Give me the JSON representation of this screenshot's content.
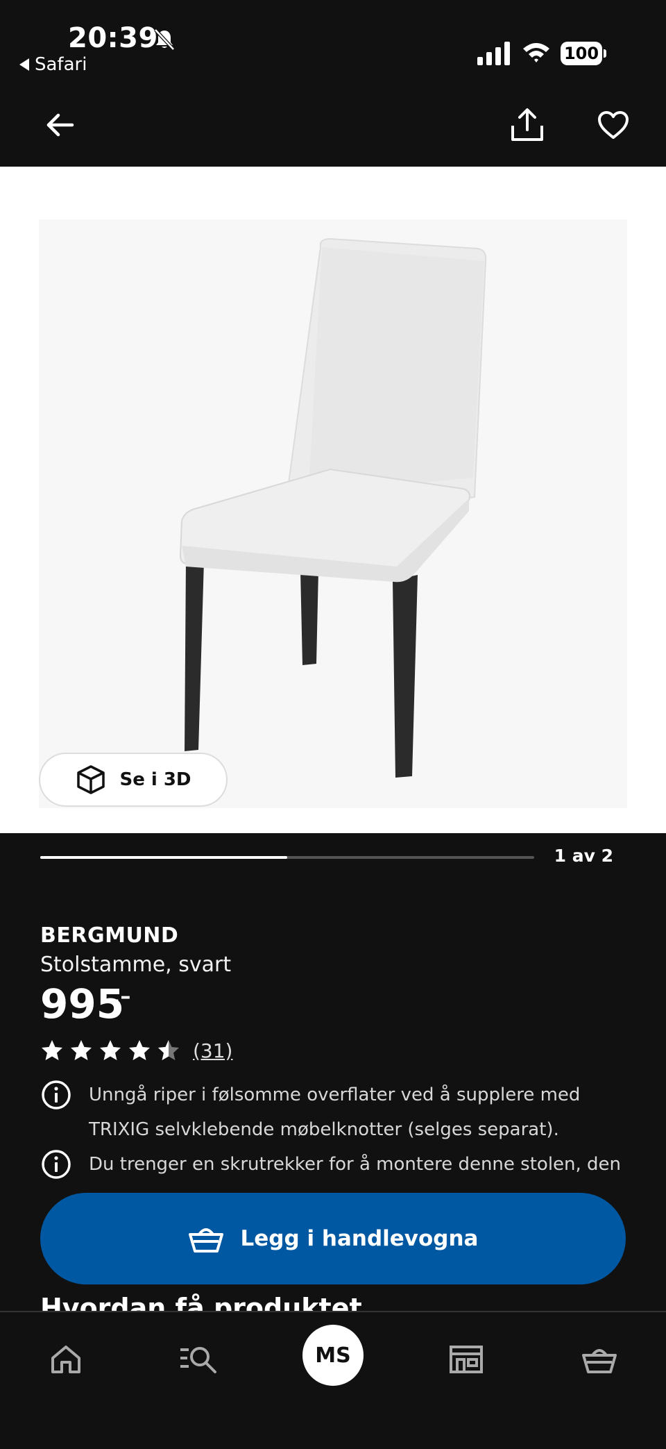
{
  "status_bar": {
    "time": "20:39",
    "back_app": "Safari",
    "battery": "100",
    "icons": [
      "bell-slash-icon",
      "signal-icon",
      "wifi-icon",
      "battery-icon"
    ]
  },
  "header": {
    "icons": [
      "arrow-left-icon",
      "share-icon",
      "heart-icon"
    ]
  },
  "gallery": {
    "view_3d_label": "Se i 3D",
    "pager": "1 av 2",
    "progress": 0.5
  },
  "product": {
    "name": "BERGMUND",
    "description": "Stolstamme, svart",
    "price": "995",
    "price_suffix": ",–",
    "rating": 4.5,
    "rating_count": "(31)",
    "notes": [
      "Unngå riper i følsomme overflater ved å supplere med TRIXIG selvklebende møbelknotter (selges separat).",
      "Du trenger en skrutrekker for å montere denne stolen, den"
    ]
  },
  "cta": {
    "label": "Legg i handlevogna"
  },
  "section": {
    "title": "Hvordan få produktet"
  },
  "bottom_nav": {
    "profile_initials": "MS",
    "items": [
      "home-icon",
      "search-list-icon",
      "profile-avatar",
      "store-icon",
      "cart-icon"
    ]
  },
  "colors": {
    "background": "#111111",
    "accent": "#0058a3",
    "image_bg": "#ffffff"
  }
}
